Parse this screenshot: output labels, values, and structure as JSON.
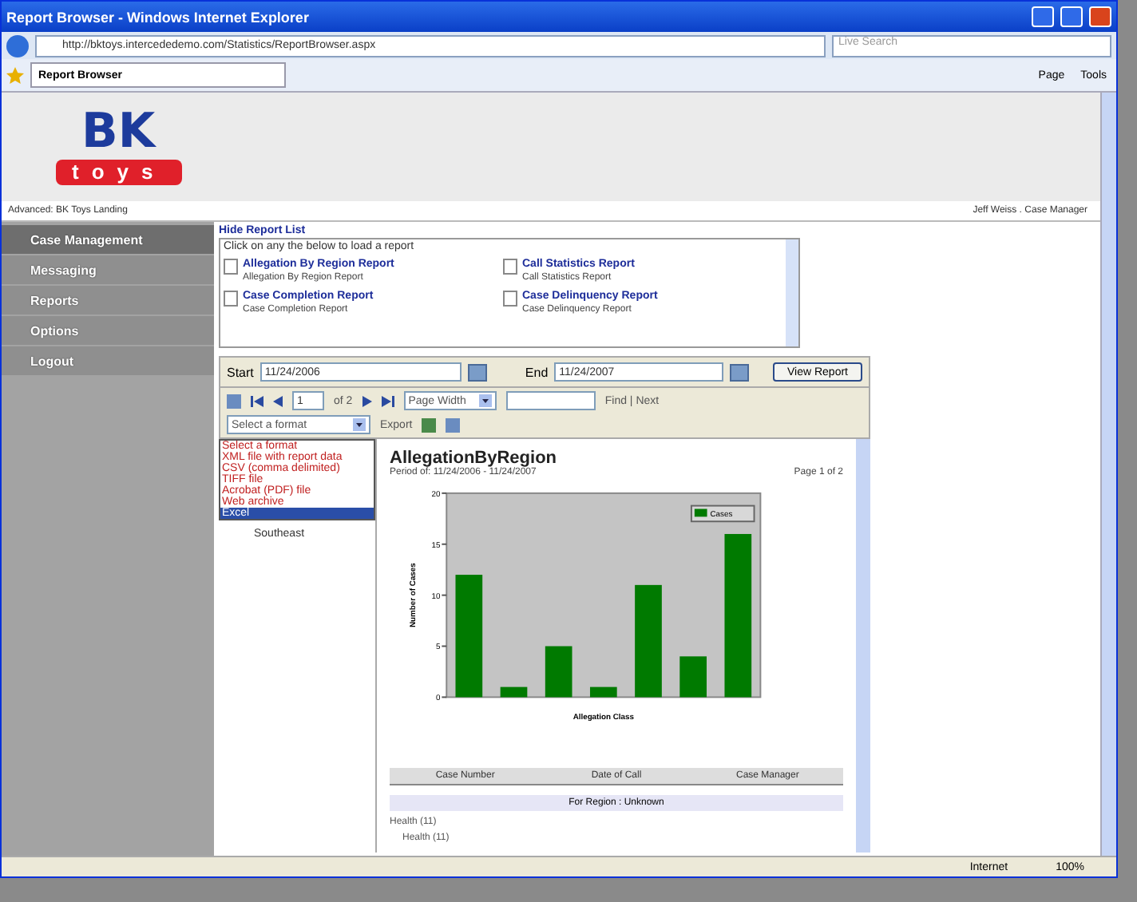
{
  "window": {
    "title": "Report Browser - Windows Internet Explorer"
  },
  "address_bar": {
    "url": "http://bktoys.intercededemo.com/Statistics/ReportBrowser.aspx",
    "search_placeholder": "Live Search"
  },
  "tabs": [
    {
      "label": "Report Browser",
      "selected": true
    }
  ],
  "command_bar": {
    "items": [
      "Page",
      "Tools"
    ]
  },
  "header": {
    "logo_big": "BK",
    "logo_small": "toys",
    "breadcrumb": "Advanced: BK Toys Landing",
    "user": "Jeff Weiss . Case Manager"
  },
  "sidebar": {
    "items": [
      {
        "label": "Case Management",
        "selected": true
      },
      {
        "label": "Messaging",
        "selected": false
      },
      {
        "label": "Reports",
        "selected": false
      },
      {
        "label": "Options",
        "selected": false
      },
      {
        "label": "Logout",
        "selected": false
      }
    ]
  },
  "report_list": {
    "toggle": "Hide Report List",
    "hint": "Click on any the below to load a report",
    "reports": [
      {
        "title": "Allegation By Region Report",
        "subtitle": "Allegation By Region Report"
      },
      {
        "title": "Call Statistics Report",
        "subtitle": "Call Statistics Report"
      },
      {
        "title": "Case Completion Report",
        "subtitle": "Case Completion Report"
      },
      {
        "title": "Case Delinquency Report",
        "subtitle": "Case Delinquency Report"
      }
    ]
  },
  "parameters": {
    "start_label": "Start",
    "start_value": "11/24/2006",
    "end_label": "End",
    "end_value": "11/24/2007",
    "button": "View Report"
  },
  "viewer_toolbar": {
    "page": "1",
    "page_count": "of 2",
    "zoom": "Page Width",
    "find_next": "Find | Next",
    "format": "Select a format",
    "export": "Export"
  },
  "format_menu": {
    "options": [
      {
        "label": "Select a format",
        "selected": false
      },
      {
        "label": "XML file with report data",
        "selected": false
      },
      {
        "label": "CSV (comma delimited)",
        "selected": false
      },
      {
        "label": "TIFF file",
        "selected": false
      },
      {
        "label": "Acrobat (PDF) file",
        "selected": false
      },
      {
        "label": "Web archive",
        "selected": false
      },
      {
        "label": "Excel",
        "selected": true
      }
    ]
  },
  "document_map": {
    "items": [
      "Southeast"
    ]
  },
  "report": {
    "title": "AllegationByRegion",
    "period": "Period of: 11/24/2006 - 11/24/2007",
    "page": "Page 1 of 2",
    "chart_data": {
      "type": "bar",
      "xlabel": "Allegation Class",
      "ylabel": "Number of Cases",
      "ylim": [
        0,
        20
      ],
      "yticks": [
        0,
        5,
        10,
        15,
        20
      ],
      "series": [
        {
          "name": "Cases",
          "color": "#007a00",
          "values": [
            12,
            1,
            5,
            1,
            11,
            4,
            16
          ]
        }
      ]
    },
    "table": {
      "columns": [
        "Case Number",
        "Date of Call",
        "Case Manager"
      ],
      "group": "For Region : Unknown",
      "subgroups": [
        "Health (11)",
        "Health (11)"
      ]
    }
  },
  "status_bar": {
    "zone": "Internet",
    "zoom": "100%"
  }
}
